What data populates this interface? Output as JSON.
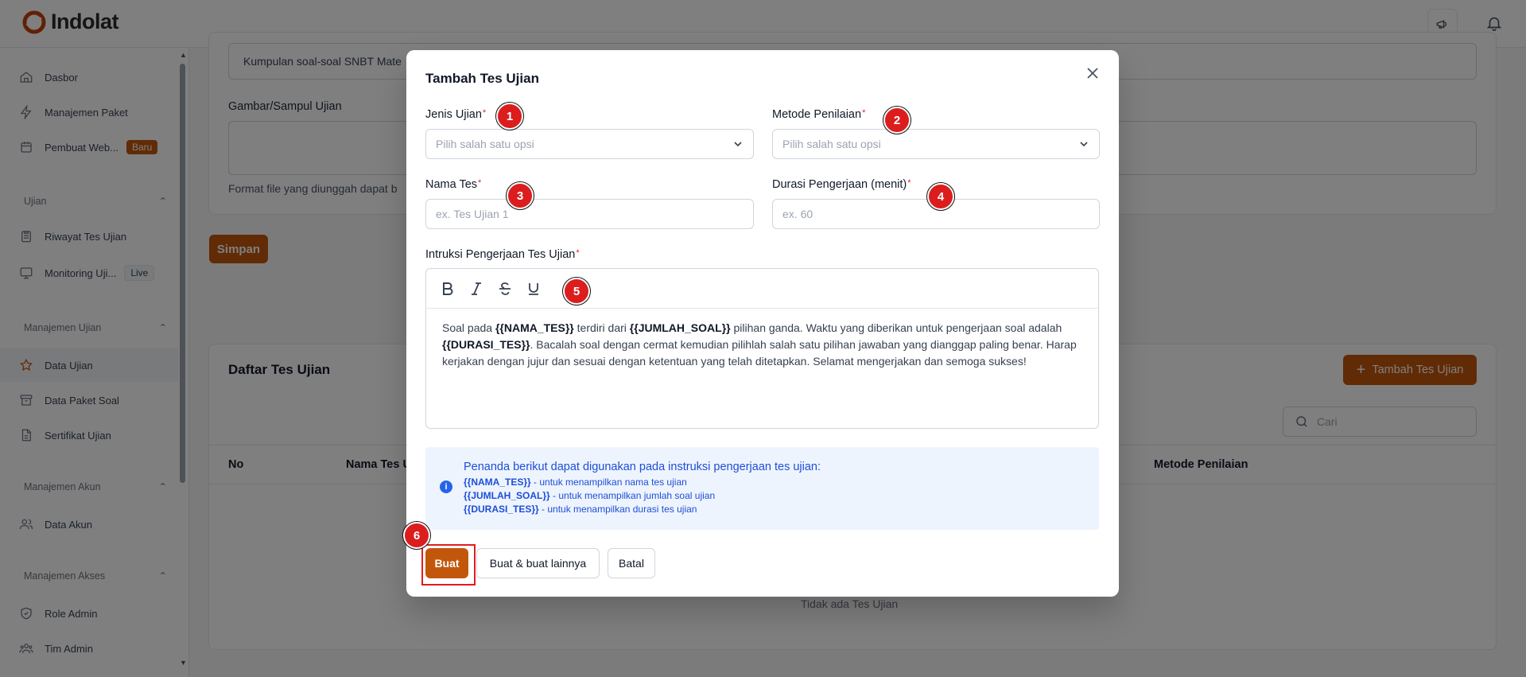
{
  "app": {
    "logo_text": "Indolat"
  },
  "sidebar": {
    "items_top": [
      {
        "label": "Dasbor",
        "icon": "home-icon"
      },
      {
        "label": "Manajemen Paket",
        "icon": "bolt-icon"
      },
      {
        "label": "Pembuat Web...",
        "icon": "calendar-icon",
        "badge": "Baru"
      }
    ],
    "sections": [
      {
        "title": "Ujian",
        "items": [
          {
            "label": "Riwayat Tes Ujian"
          },
          {
            "label": "Monitoring Uji...",
            "badge": "Live"
          }
        ]
      },
      {
        "title": "Manajemen Ujian",
        "items": [
          {
            "label": "Data Ujian"
          },
          {
            "label": "Data Paket Soal"
          },
          {
            "label": "Sertifikat Ujian"
          }
        ]
      },
      {
        "title": "Manajemen Akun",
        "items": [
          {
            "label": "Data Akun"
          }
        ]
      },
      {
        "title": "Manajemen Akses",
        "items": [
          {
            "label": "Role Admin"
          },
          {
            "label": "Tim Admin"
          }
        ]
      }
    ]
  },
  "background": {
    "description_value": "Kumpulan soal-soal SNBT Mate",
    "cover_label": "Gambar/Sampul Ujian",
    "file_note": "Format file yang diunggah dapat b",
    "save_button": "Simpan",
    "list_title": "Daftar Tes Ujian",
    "add_button": "Tambah Tes Ujian",
    "search_placeholder": "Cari",
    "columns": [
      "No",
      "Nama Tes U",
      "Metode Penilaian"
    ],
    "empty_text": "Tidak ada Tes Ujian"
  },
  "modal": {
    "title": "Tambah Tes Ujian",
    "fields": {
      "jenis_ujian": {
        "label": "Jenis Ujian",
        "placeholder": "Pilih salah satu opsi"
      },
      "metode_penilaian": {
        "label": "Metode Penilaian",
        "placeholder": "Pilih salah satu opsi"
      },
      "nama_tes": {
        "label": "Nama Tes",
        "placeholder": "ex. Tes Ujian 1"
      },
      "durasi": {
        "label": "Durasi Pengerjaan (menit)",
        "placeholder": "ex. 60"
      },
      "instruksi": {
        "label": "Intruksi Pengerjaan Tes Ujian"
      }
    },
    "editor_text": {
      "p1": "Soal pada ",
      "t1": "{{NAMA_TES}}",
      "p2": " terdiri dari ",
      "t2": "{{JUMLAH_SOAL}}",
      "p3": " pilihan ganda. Waktu yang diberikan untuk pengerjaan soal adalah ",
      "t3": "{{DURASI_TES}}",
      "p4": ". Bacalah soal dengan cermat kemudian pilihlah salah satu pilihan jawaban yang dianggap paling benar. Harap kerjakan dengan jujur dan sesuai dengan ketentuan yang telah ditetapkan. Selamat mengerjakan dan semoga sukses!"
    },
    "info": {
      "title": "Penanda berikut dapat digunakan pada instruksi pengerjaan tes ujian:",
      "lines": [
        {
          "tag": "{{NAMA_TES}}",
          "desc": " - untuk menampilkan nama tes ujian"
        },
        {
          "tag": "{{JUMLAH_SOAL}}",
          "desc": " - untuk menampilkan jumlah soal ujian"
        },
        {
          "tag": "{{DURASI_TES}}",
          "desc": " - untuk menampilkan durasi tes ujian"
        }
      ]
    },
    "buttons": {
      "create": "Buat",
      "create_more": "Buat & buat lainnya",
      "cancel": "Batal"
    }
  },
  "markers": [
    "1",
    "2",
    "3",
    "4",
    "5",
    "6"
  ],
  "colors": {
    "accent": "#c2570c",
    "marker": "#dc1d1d",
    "info_text": "#1d4ed8"
  }
}
